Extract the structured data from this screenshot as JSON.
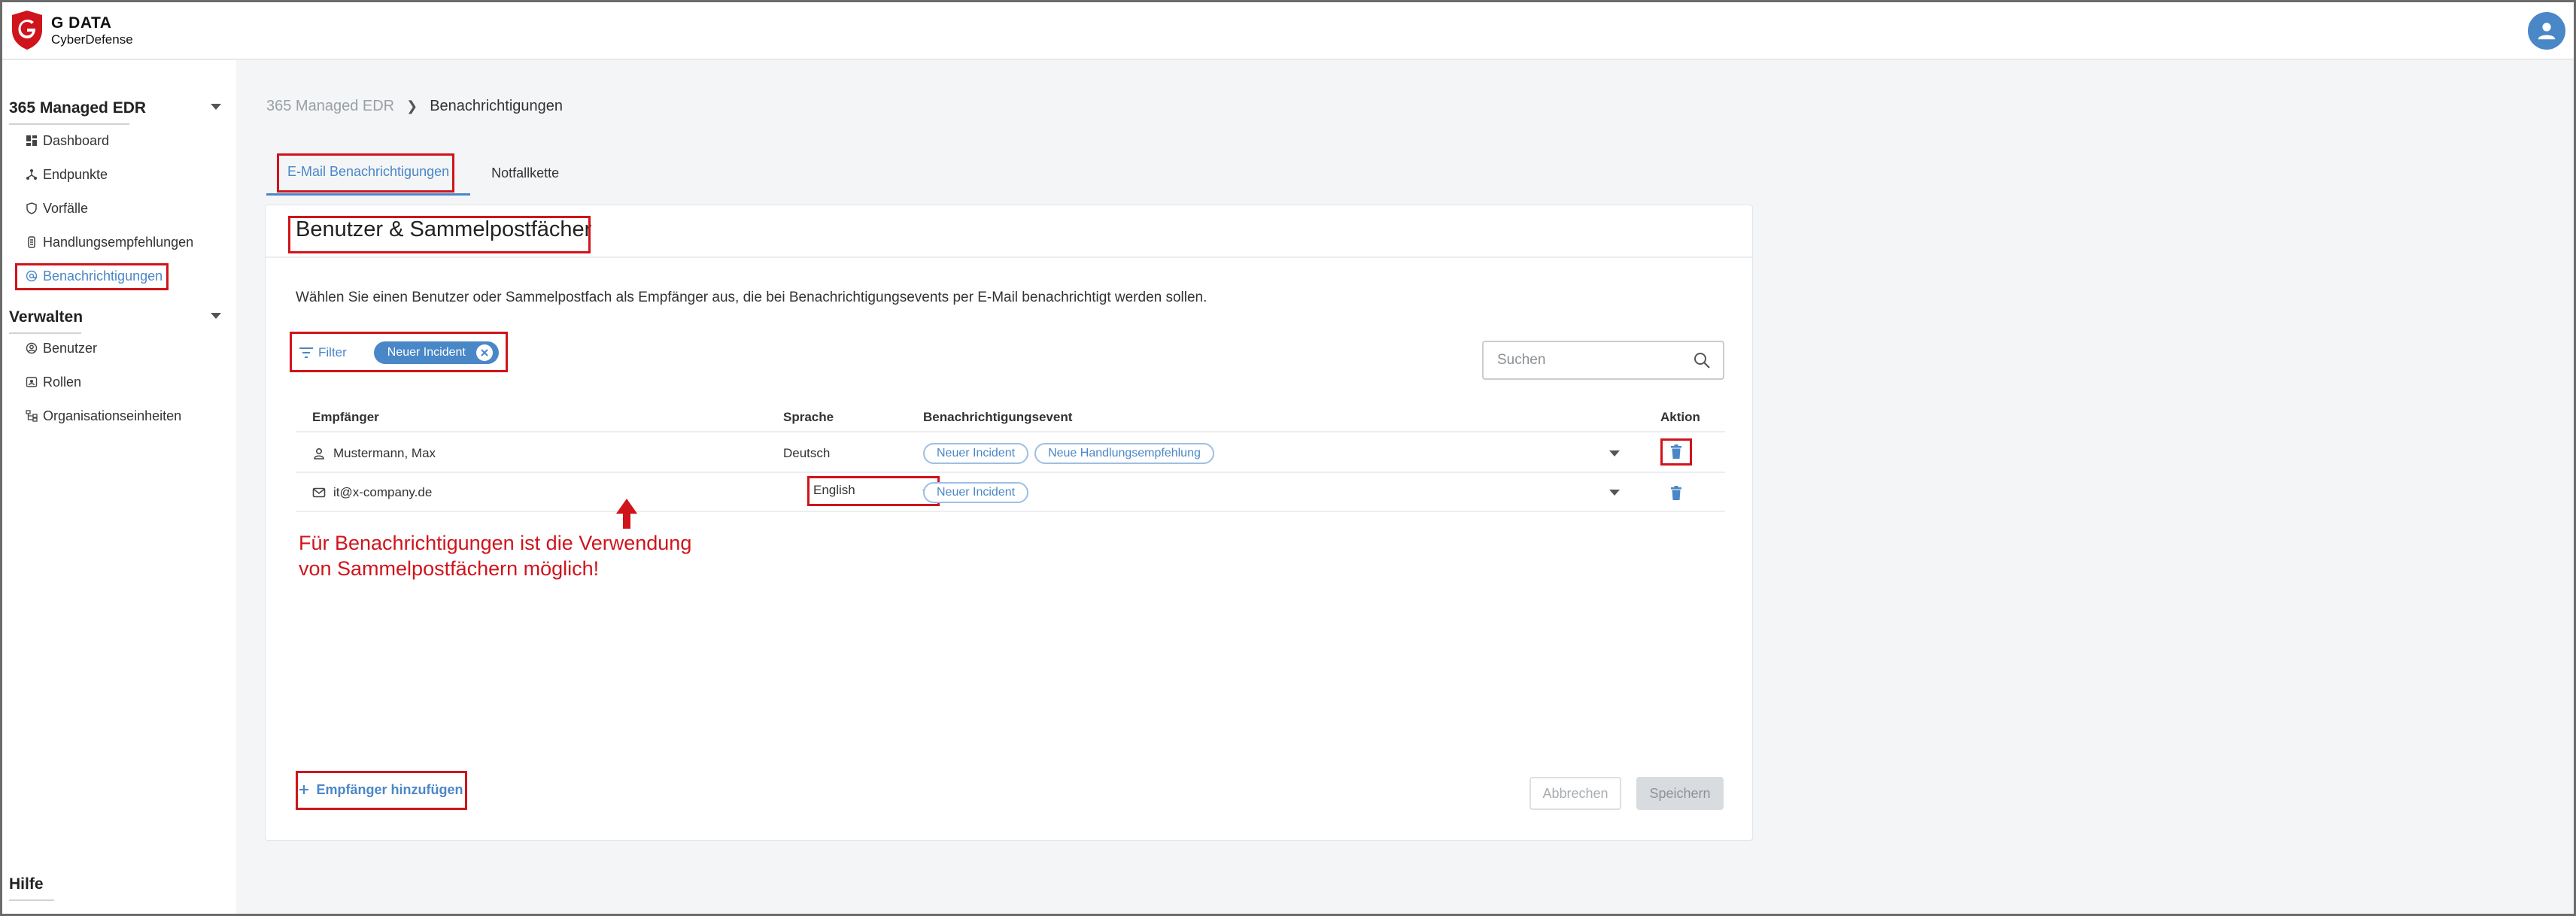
{
  "app": {
    "logo_line1": "G DATA",
    "logo_line2": "CyberDefense",
    "brand_color": "#d0141c",
    "accent_color": "#4a87c7"
  },
  "sidebar": {
    "group1": "365 Managed EDR",
    "items1": [
      {
        "label": "Dashboard",
        "icon": "dashboard-icon"
      },
      {
        "label": "Endpunkte",
        "icon": "endpoints-icon"
      },
      {
        "label": "Vorfälle",
        "icon": "shield-icon"
      },
      {
        "label": "Handlungsempfehlungen",
        "icon": "recommendation-icon"
      },
      {
        "label": "Benachrichtigungen",
        "icon": "at-icon",
        "active": true
      }
    ],
    "group2": "Verwalten",
    "items2": [
      {
        "label": "Benutzer",
        "icon": "user-circle-icon"
      },
      {
        "label": "Rollen",
        "icon": "role-icon"
      },
      {
        "label": "Organisationseinheiten",
        "icon": "org-units-icon"
      }
    ],
    "help": "Hilfe"
  },
  "breadcrumb": {
    "parent": "365 Managed EDR",
    "current": "Benachrichtigungen"
  },
  "tabs": [
    {
      "label": "E-Mail Benachrichtigungen",
      "active": true
    },
    {
      "label": "Notfallkette",
      "active": false
    }
  ],
  "card": {
    "title": "Benutzer & Sammelpostfächer",
    "description": "Wählen Sie einen Benutzer oder Sammelpostfach als Empfänger aus, die bei Benachrichtigungsevents per E-Mail benachrichtigt werden sollen.",
    "filter_label": "Filter",
    "filter_chip": "Neuer Incident",
    "search_placeholder": "Suchen"
  },
  "table": {
    "headers": {
      "recipient": "Empfänger",
      "language": "Sprache",
      "event": "Benachrichtigungsevent",
      "action": "Aktion"
    },
    "rows": [
      {
        "type": "user",
        "recipient": "Mustermann, Max",
        "language": "Deutsch",
        "events": [
          "Neuer Incident",
          "Neue Handlungsempfehlung"
        ]
      },
      {
        "type": "mailbox",
        "recipient": "it@x-company.de",
        "language": "English",
        "events": [
          "Neuer Incident"
        ]
      }
    ]
  },
  "annotation": {
    "line1": "Für Benachrichtigungen ist die Verwendung",
    "line2": "von Sammelpostfächern möglich!"
  },
  "footer": {
    "add_label": "Empfänger hinzufügen",
    "cancel_label": "Abbrechen",
    "save_label": "Speichern"
  }
}
